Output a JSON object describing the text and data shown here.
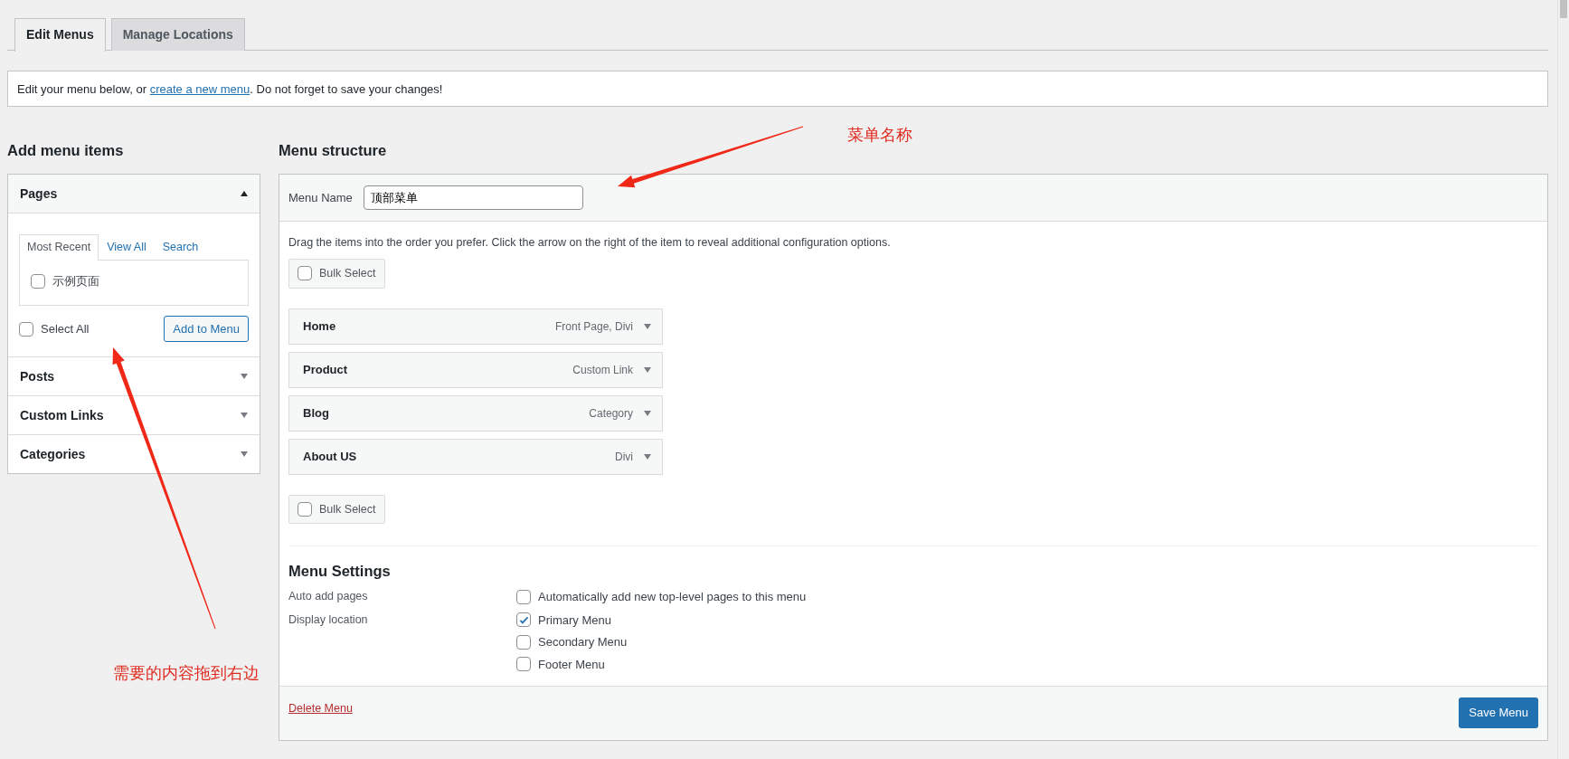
{
  "tabs": [
    {
      "label": "Edit Menus",
      "selected": true
    },
    {
      "label": "Manage Locations",
      "selected": false
    }
  ],
  "notice": {
    "before": "Edit your menu below, or ",
    "link": "create a new menu",
    "after": ". Do not forget to save your changes!"
  },
  "add_menu_items": {
    "title": "Add menu items",
    "sections": [
      {
        "title": "Pages",
        "expanded": true,
        "tabs": [
          {
            "label": "Most Recent",
            "selected": true
          },
          {
            "label": "View All",
            "selected": false
          },
          {
            "label": "Search",
            "selected": false
          }
        ],
        "items": [
          {
            "label": "示例页面",
            "checked": false
          }
        ],
        "select_all": {
          "label": "Select All",
          "checked": false
        },
        "button": "Add to Menu"
      },
      {
        "title": "Posts",
        "expanded": false
      },
      {
        "title": "Custom Links",
        "expanded": false
      },
      {
        "title": "Categories",
        "expanded": false
      }
    ]
  },
  "menu_structure": {
    "title": "Menu structure",
    "menu_name_label": "Menu Name",
    "menu_name_value": "顶部菜单",
    "instructions": "Drag the items into the order you prefer. Click the arrow on the right of the item to reveal additional configuration options.",
    "bulk_select_top": {
      "label": "Bulk Select",
      "checked": false
    },
    "items": [
      {
        "title": "Home",
        "type": "Front Page, Divi"
      },
      {
        "title": "Product",
        "type": "Custom Link"
      },
      {
        "title": "Blog",
        "type": "Category"
      },
      {
        "title": "About US",
        "type": "Divi"
      }
    ],
    "bulk_select_bottom": {
      "label": "Bulk Select",
      "checked": false
    },
    "settings": {
      "title": "Menu Settings",
      "rows": [
        {
          "label": "Auto add pages",
          "options": [
            {
              "label": "Automatically add new top-level pages to this menu",
              "checked": false
            }
          ]
        },
        {
          "label": "Display location",
          "options": [
            {
              "label": "Primary Menu",
              "checked": true
            },
            {
              "label": "Secondary Menu",
              "checked": false
            },
            {
              "label": "Footer Menu",
              "checked": false
            }
          ]
        }
      ]
    },
    "delete_link": "Delete Menu",
    "save_button": "Save Menu"
  },
  "annotations": [
    {
      "text": "菜单名称"
    },
    {
      "text": "需要的内容拖到右边"
    }
  ]
}
